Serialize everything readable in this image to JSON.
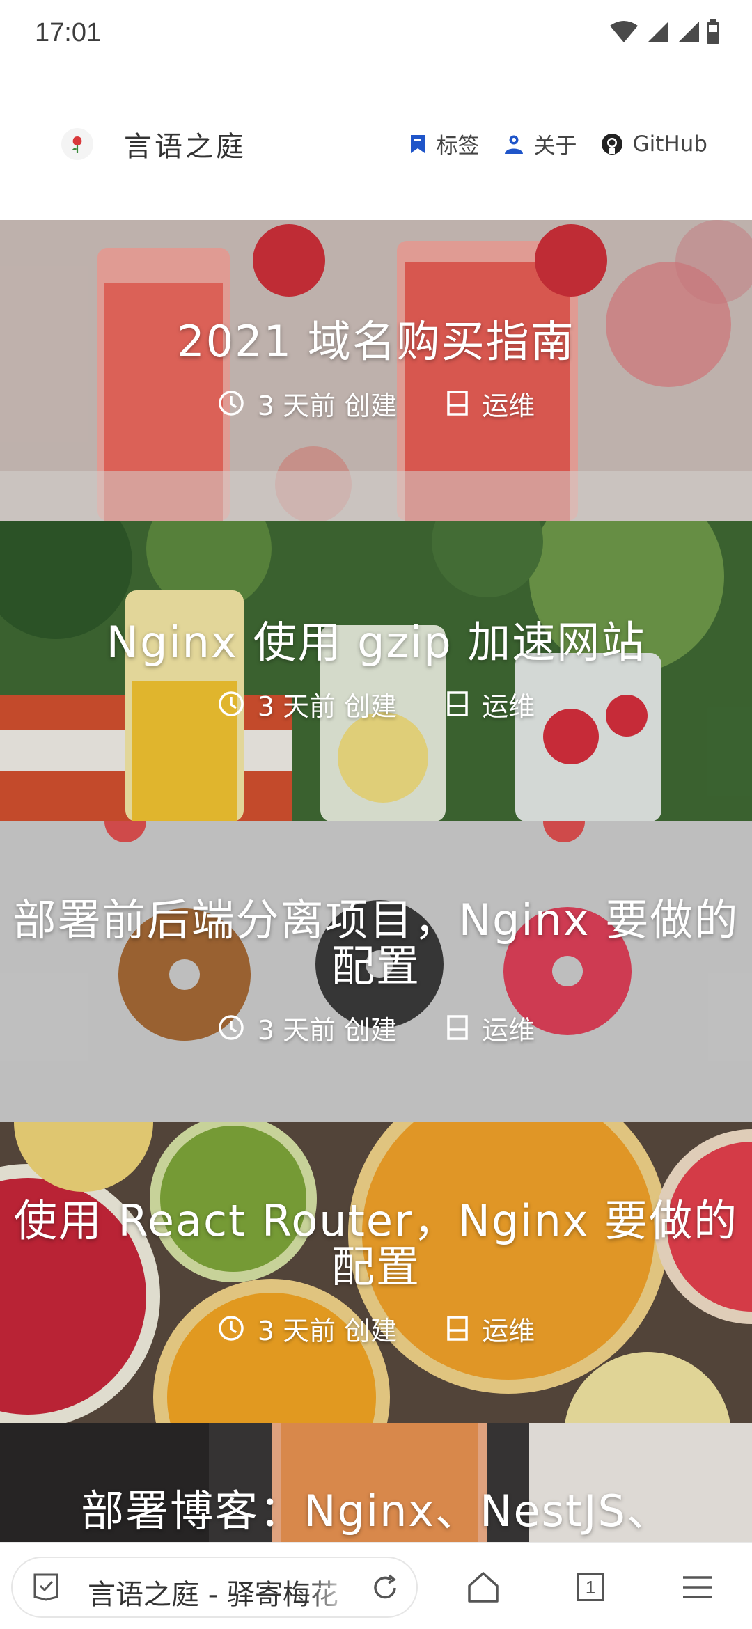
{
  "status_bar": {
    "time": "17:01"
  },
  "header": {
    "site_title": "言语之庭",
    "nav": [
      {
        "label": "标签",
        "icon": "bookmark-icon"
      },
      {
        "label": "关于",
        "icon": "user-icon"
      },
      {
        "label": "GitHub",
        "icon": "github-icon"
      }
    ]
  },
  "posts": [
    {
      "title": "2021 域名购买指南",
      "time": "3 天前 创建",
      "category": "运维",
      "theme": "strawberry-juice",
      "accent": "#e96a5e"
    },
    {
      "title": "Nginx 使用 gzip 加速网站",
      "time": "3 天前 创建",
      "category": "运维",
      "theme": "lemonade-drinks",
      "accent": "#5e8b3f"
    },
    {
      "title": "部署前后端分离项目，Nginx 要做的配置",
      "time": "3 天前 创建",
      "category": "运维",
      "theme": "donuts",
      "accent": "#c8c8c8"
    },
    {
      "title": "使用 React Router，Nginx 要做的配置",
      "time": "3 天前 创建",
      "category": "运维",
      "theme": "citrus-slices",
      "accent": "#f3a32a"
    },
    {
      "title": "部署博客：Nginx、NestJS、",
      "theme": "orange-drink",
      "accent": "#e8893a"
    }
  ],
  "browser": {
    "url_text": "言语之庭 - 驿寄梅花",
    "tab_count": "1"
  }
}
